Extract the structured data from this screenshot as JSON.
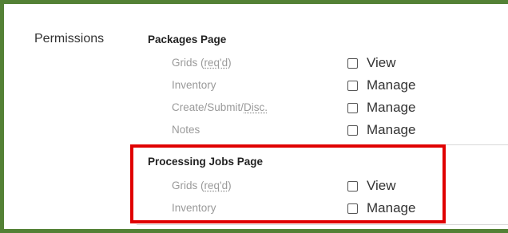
{
  "permissions": {
    "label": "Permissions",
    "groups": [
      {
        "title": "Packages Page",
        "rows": [
          {
            "label": "Grids (",
            "abbr": "req'd",
            "label_suffix": ")",
            "option": "View"
          },
          {
            "label": "Inventory",
            "abbr": "",
            "label_suffix": "",
            "option": "Manage"
          },
          {
            "label": "Create/Submit/",
            "abbr": "Disc.",
            "label_suffix": "",
            "option": "Manage"
          },
          {
            "label": "Notes",
            "abbr": "",
            "label_suffix": "",
            "option": "Manage"
          }
        ]
      },
      {
        "title": "Processing Jobs Page",
        "rows": [
          {
            "label": "Grids (",
            "abbr": "req'd",
            "label_suffix": ")",
            "option": "View"
          },
          {
            "label": "Inventory",
            "abbr": "",
            "label_suffix": "",
            "option": "Manage"
          }
        ]
      }
    ]
  },
  "colors": {
    "frame_border": "#538135",
    "highlight_box": "#e00000",
    "label_gray": "#9a9a9a"
  }
}
